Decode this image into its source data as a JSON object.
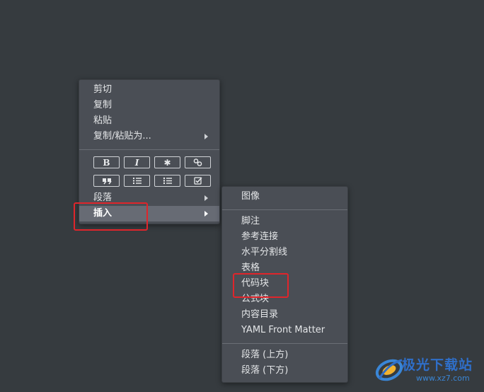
{
  "context_menu": {
    "items": [
      {
        "label": "剪切"
      },
      {
        "label": "复制"
      },
      {
        "label": "粘贴"
      },
      {
        "label": "复制/粘贴为..."
      }
    ],
    "format_buttons": [
      {
        "icon": "bold-icon",
        "glyph": "B"
      },
      {
        "icon": "italic-icon",
        "glyph": "I"
      },
      {
        "icon": "code-icon",
        "glyph": "✱"
      },
      {
        "icon": "link-icon",
        "glyph": ""
      },
      {
        "icon": "quote-icon",
        "glyph": ""
      },
      {
        "icon": "ordered-list-icon",
        "glyph": ""
      },
      {
        "icon": "unordered-list-icon",
        "glyph": ""
      },
      {
        "icon": "task-list-icon",
        "glyph": ""
      }
    ],
    "paragraph_label": "段落",
    "insert_label": "插入"
  },
  "submenu": {
    "image_label": "图像",
    "items": [
      {
        "label": "脚注"
      },
      {
        "label": "参考连接"
      },
      {
        "label": "水平分割线"
      },
      {
        "label": "表格"
      },
      {
        "label": "代码块"
      },
      {
        "label": "公式块"
      },
      {
        "label": "内容目录"
      },
      {
        "label": "YAML Front Matter"
      }
    ],
    "paragraph_above": "段落 (上方)",
    "paragraph_below": "段落 (下方)"
  },
  "watermark": {
    "title": "极光下载站",
    "url": "www.xz7.com"
  },
  "colors": {
    "background": "#363b3f",
    "menu_bg": "#4a4e55",
    "active_item": "#676b74",
    "highlight_box": "#e0252b",
    "watermark_blue": "#2f6fc9"
  }
}
